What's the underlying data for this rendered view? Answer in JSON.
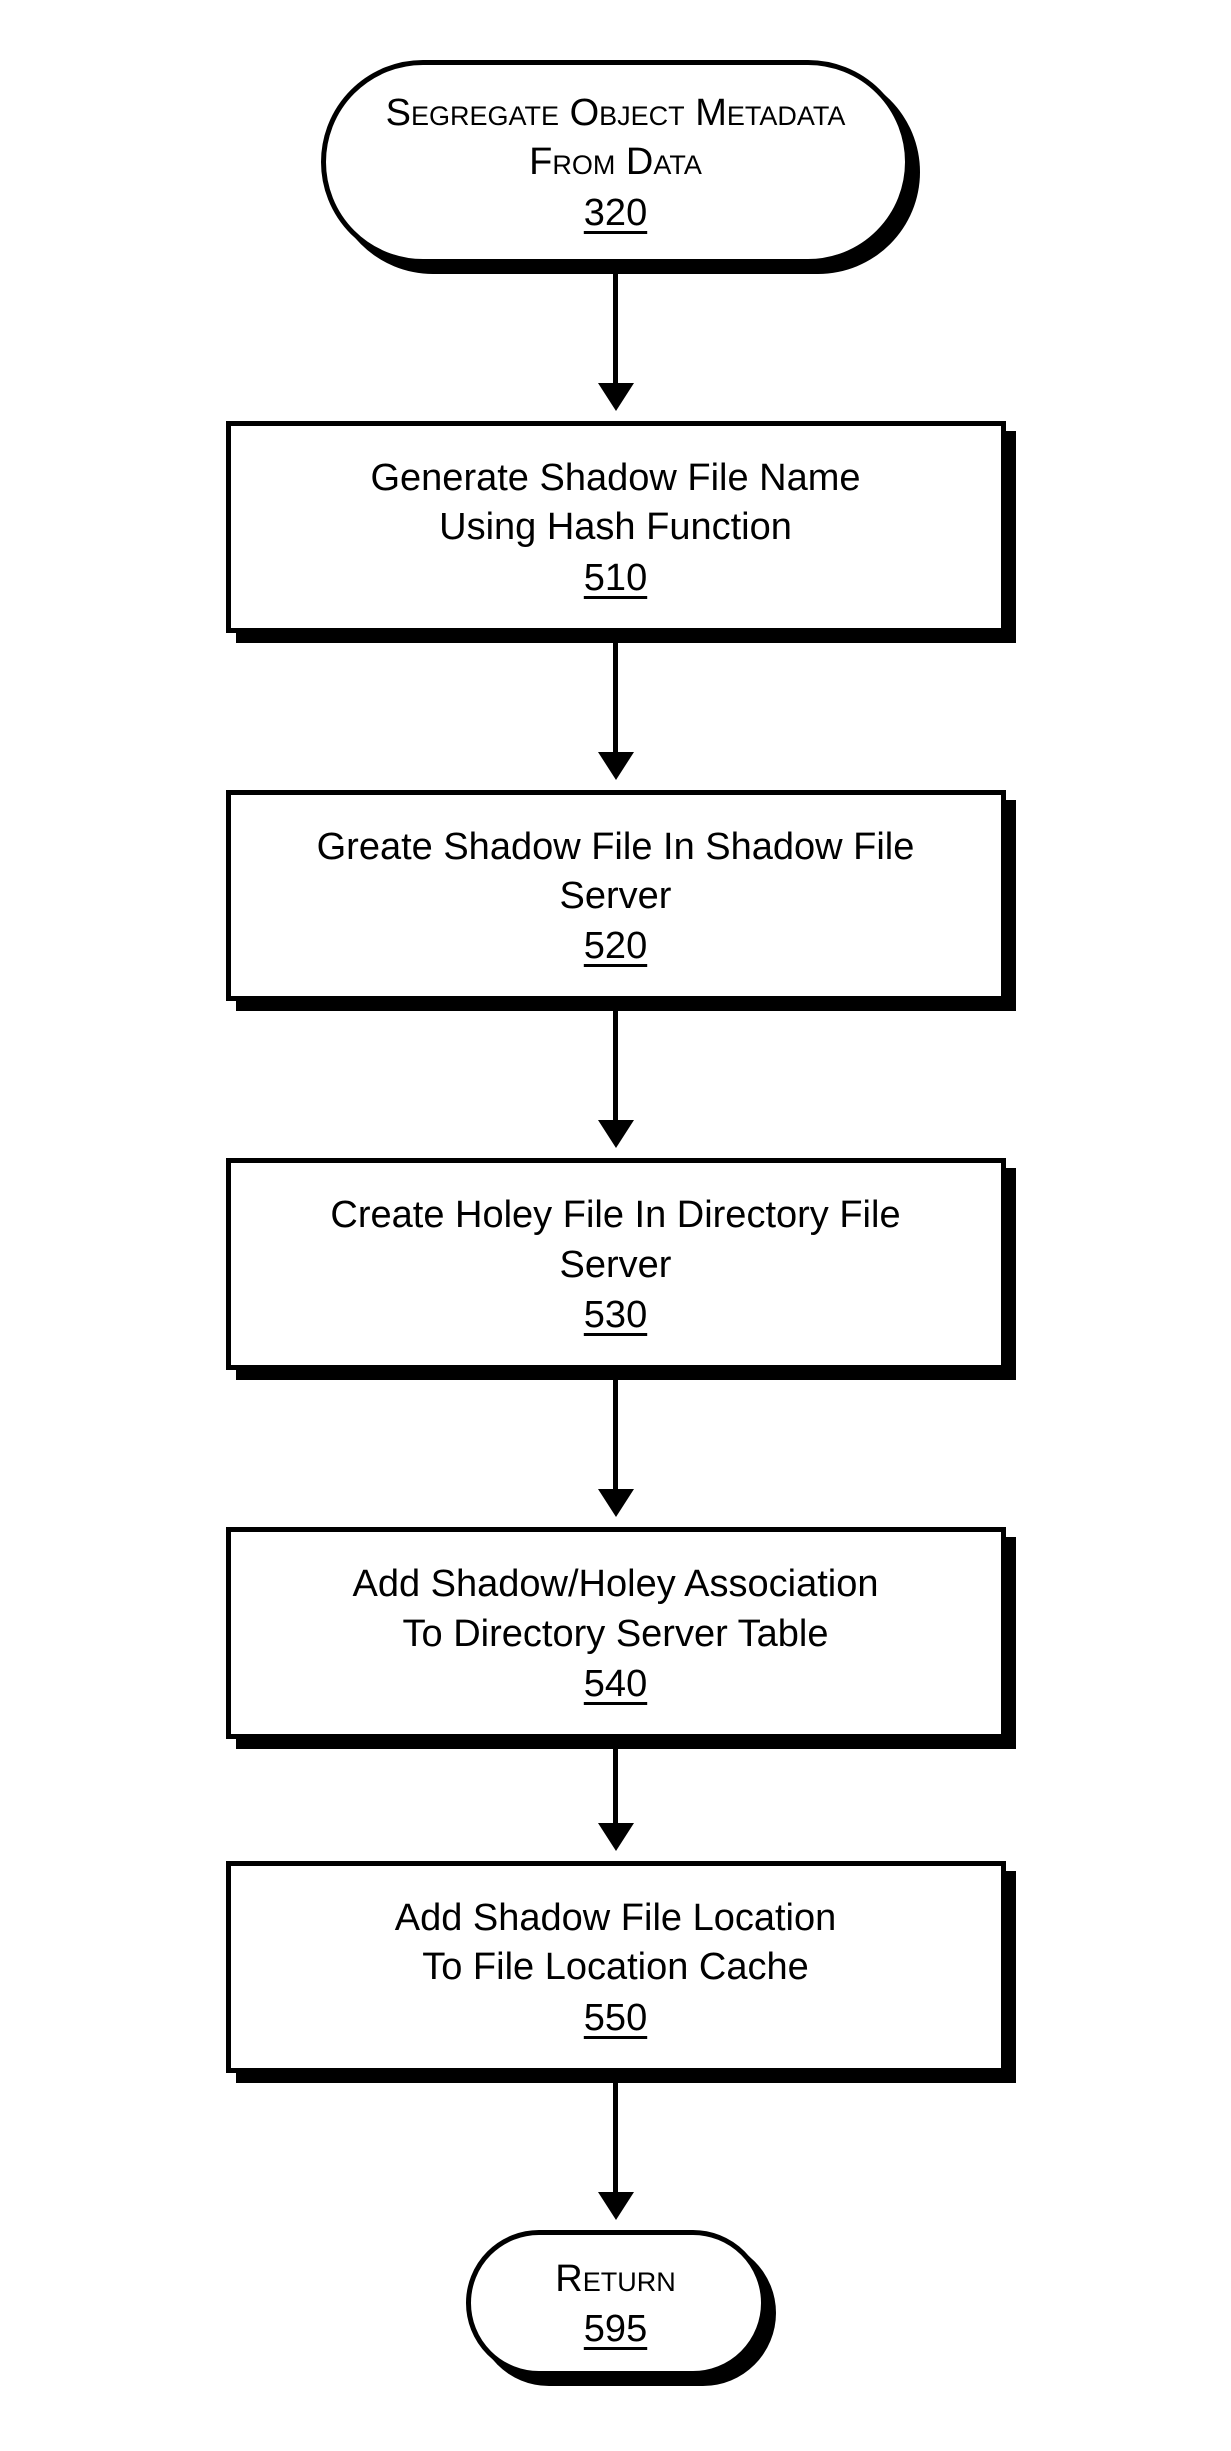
{
  "flowchart": {
    "start": {
      "line1": "Segregate Object Metadata",
      "line2": "From Data",
      "number": "320"
    },
    "step1": {
      "line1": "Generate Shadow File Name",
      "line2": "Using Hash Function",
      "number": "510"
    },
    "step2": {
      "line1": "Greate Shadow File In Shadow File Server",
      "number": "520"
    },
    "step3": {
      "line1": "Create Holey File In Directory File Server",
      "number": "530"
    },
    "step4": {
      "line1": "Add Shadow/Holey Association",
      "line2": "To Directory Server Table",
      "number": "540"
    },
    "step5": {
      "line1": "Add Shadow File Location",
      "line2": "To File Location Cache",
      "number": "550"
    },
    "end": {
      "line1": "Return",
      "number": "595"
    }
  }
}
